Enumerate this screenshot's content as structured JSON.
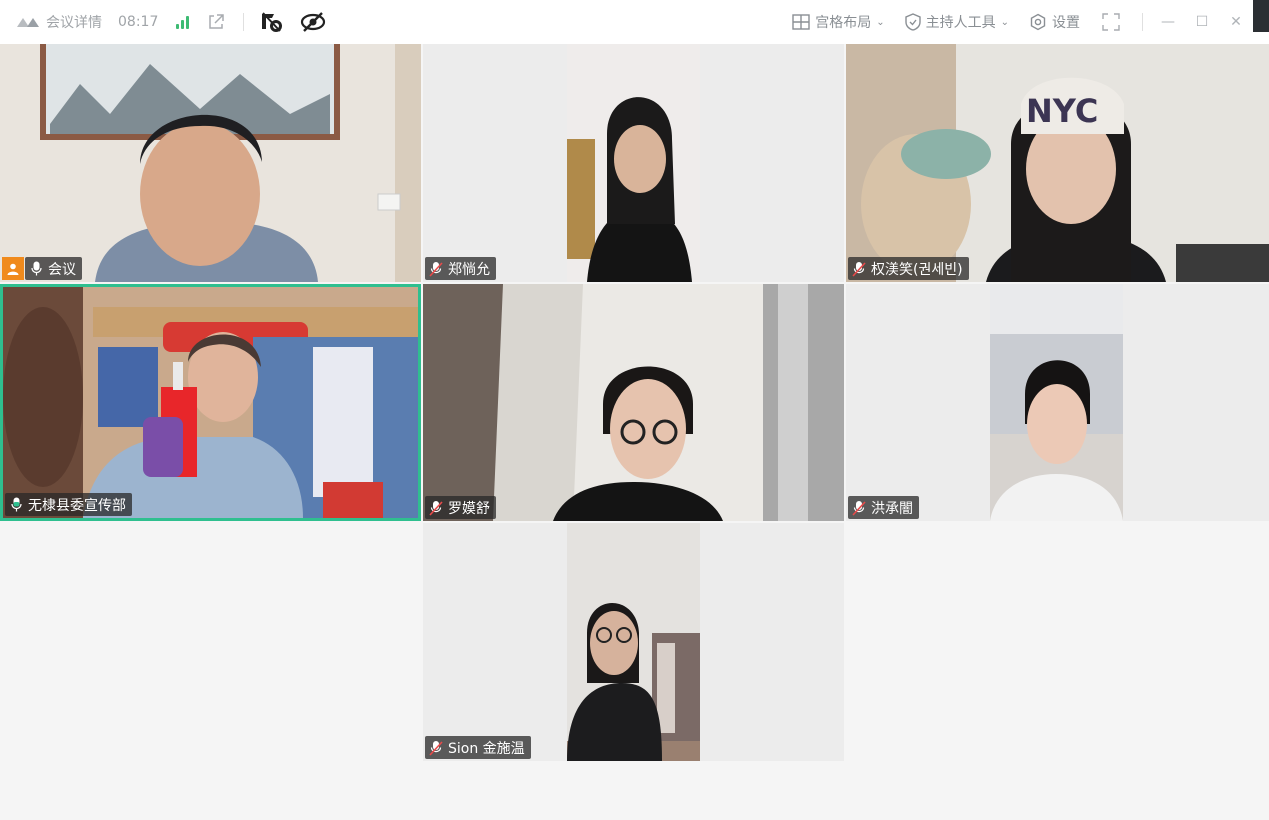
{
  "titlebar": {
    "meeting_details": "会议详情",
    "time": "08:17",
    "layout_label": "宫格布局",
    "host_tools_label": "主持人工具",
    "settings_label": "设置"
  },
  "participants": [
    {
      "name": "会议",
      "muted": false,
      "host": true
    },
    {
      "name": "郑惝允",
      "muted": true
    },
    {
      "name": "权渼笑(권세빈)",
      "muted": true
    },
    {
      "name": "无棣县委宣传部",
      "muted": false,
      "speaking": true
    },
    {
      "name": "罗嫫舒",
      "muted": true
    },
    {
      "name": "洪承闇",
      "muted": true
    },
    {
      "name": "Sion 金施温",
      "muted": true
    }
  ],
  "colors": {
    "accent_speaking": "#2fbf8f",
    "host_badge": "#f08a1c",
    "signal_green": "#3dbb73",
    "muted_red": "#e84a4a"
  }
}
